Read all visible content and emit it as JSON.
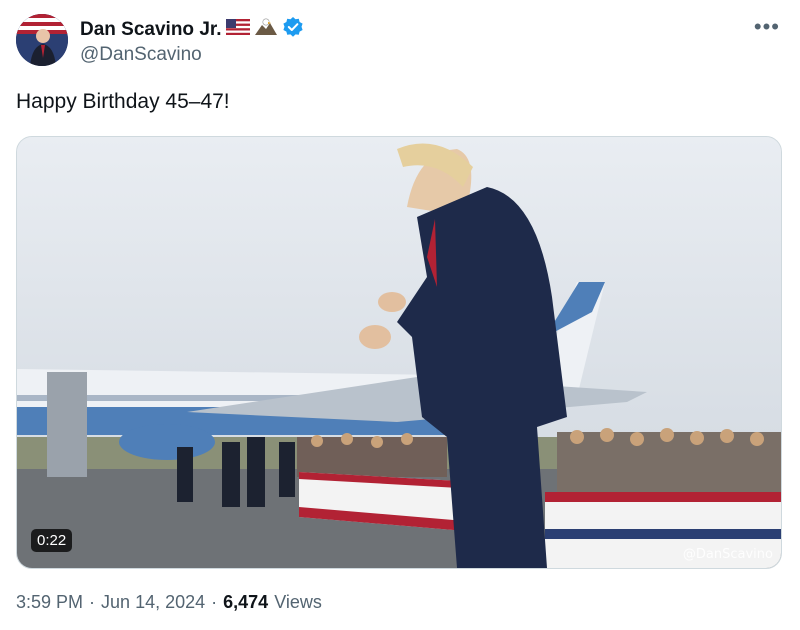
{
  "author": {
    "display_name": "Dan Scavino Jr.",
    "handle": "@DanScavino",
    "verified": true,
    "name_emojis": [
      "us-flag-icon",
      "eagle-icon"
    ]
  },
  "tweet": {
    "text": "Happy Birthday 45–47!"
  },
  "media": {
    "type": "video",
    "duration": "0:22",
    "watermark": "@DanScavino"
  },
  "meta": {
    "time": "3:59 PM",
    "date": "Jun 14, 2024",
    "views_count": "6,474",
    "views_label": "Views"
  },
  "colors": {
    "text": "#0f1419",
    "secondary": "#536471",
    "verified": "#1d9bf0",
    "border": "#cfd9de"
  }
}
